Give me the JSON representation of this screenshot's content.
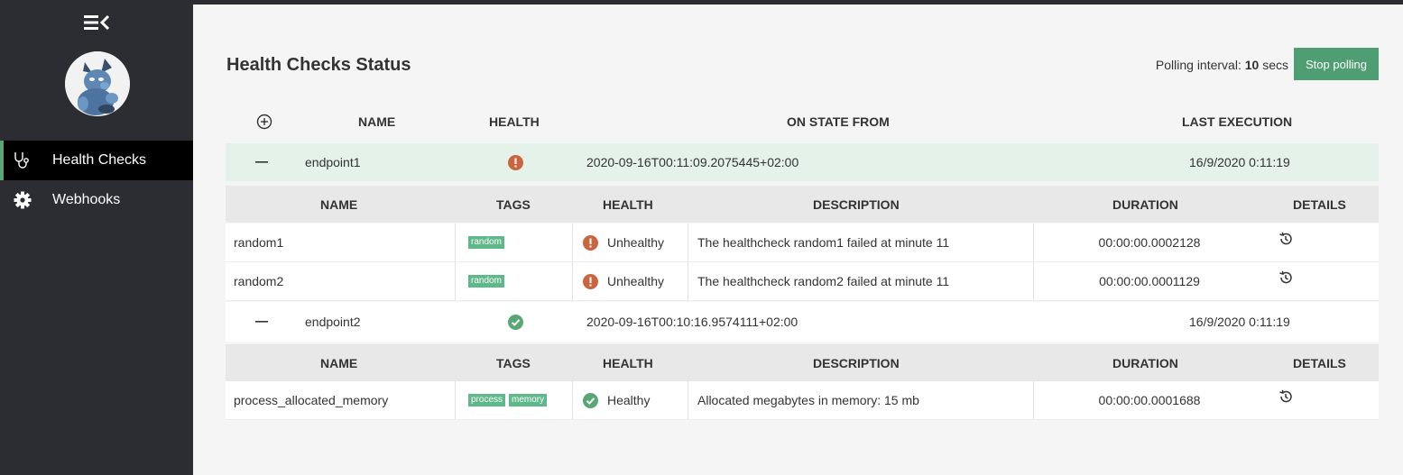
{
  "sidebar": {
    "menu_icon": "menu-collapse-icon",
    "avatar": "avatar-mascot",
    "items": [
      {
        "label": "Health Checks",
        "icon": "stethoscope-icon"
      },
      {
        "label": "Webhooks",
        "icon": "gear-icon"
      }
    ]
  },
  "header": {
    "title": "Health Checks Status",
    "polling_label": "Polling interval:",
    "polling_value": "10",
    "polling_unit": "secs",
    "stop_button": "Stop polling"
  },
  "table": {
    "columns": {
      "name": "NAME",
      "health": "HEALTH",
      "on_state_from": "ON STATE FROM",
      "last_execution": "LAST EXECUTION"
    },
    "sub_columns": {
      "name": "NAME",
      "tags": "TAGS",
      "health": "HEALTH",
      "description": "DESCRIPTION",
      "duration": "DURATION",
      "details": "DETAILS"
    },
    "endpoints": [
      {
        "name": "endpoint1",
        "status": "unhealthy",
        "on_state_from": "2020-09-16T00:11:09.2075445+02:00",
        "last_execution": "16/9/2020 0:11:19",
        "entries": [
          {
            "name": "random1",
            "tags": [
              "random"
            ],
            "health": "Unhealthy",
            "description": "The healthcheck random1 failed at minute 11",
            "duration": "00:00:00.0002128"
          },
          {
            "name": "random2",
            "tags": [
              "random"
            ],
            "health": "Unhealthy",
            "description": "The healthcheck random2 failed at minute 11",
            "duration": "00:00:00.0001129"
          }
        ]
      },
      {
        "name": "endpoint2",
        "status": "healthy",
        "on_state_from": "2020-09-16T00:10:16.9574111+02:00",
        "last_execution": "16/9/2020 0:11:19",
        "entries": [
          {
            "name": "process_allocated_memory",
            "tags": [
              "process",
              "memory"
            ],
            "health": "Healthy",
            "description": "Allocated megabytes in memory: 15 mb",
            "duration": "00:00:00.0001688"
          }
        ]
      }
    ]
  },
  "colors": {
    "sidebar_bg": "#2b2d33",
    "accent_green": "#4f9e73",
    "unhealthy": "#c9653f",
    "healthy": "#5aa776",
    "tag_bg": "#5eb88a",
    "selected_row": "#e4f2ea"
  }
}
